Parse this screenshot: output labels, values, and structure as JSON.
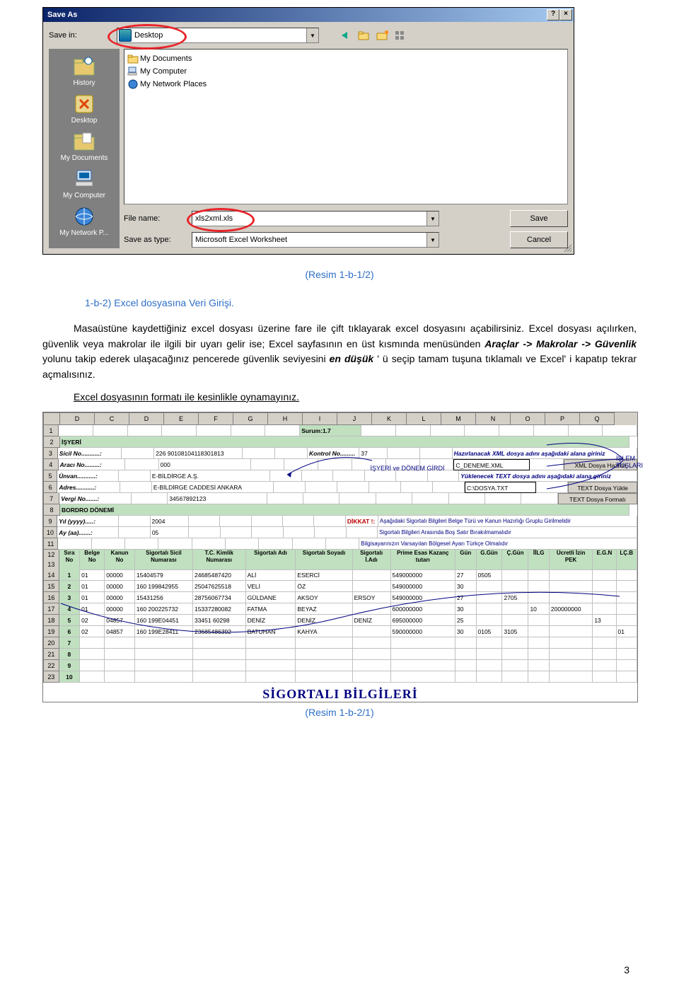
{
  "dialog": {
    "title": "Save As",
    "help_btn": "?",
    "close_btn": "×",
    "save_in_label": "Save in:",
    "save_in_value": "Desktop",
    "places": [
      {
        "label": "History"
      },
      {
        "label": "Desktop"
      },
      {
        "label": "My Documents"
      },
      {
        "label": "My Computer"
      },
      {
        "label": "My Network P..."
      }
    ],
    "files": [
      {
        "name": "My Documents"
      },
      {
        "name": "My Computer"
      },
      {
        "name": "My Network Places"
      }
    ],
    "file_name_label": "File name:",
    "file_name_value": "xls2xml.xls",
    "save_type_label": "Save as type:",
    "save_type_value": "Microsoft Excel Worksheet",
    "save_btn": "Save",
    "cancel_btn": "Cancel"
  },
  "caption1": "(Resim 1-b-1/2)",
  "heading": "1-b-2) Excel dosyasına Veri Girişi.",
  "para1_a": "Masaüstüne kaydettiğiniz excel dosyası üzerine fare ile çift tıklayarak excel dosyasını açabilirsiniz. Excel dosyası açılırken, güvenlik veya makrolar ile ilgili bir uyarı gelir ise; Excel sayfasının en üst kısmında menüsünden ",
  "para1_b": "Araçlar -> Makrolar -> Güvenlik",
  "para1_c": " yolunu takip ederek ulaşacağınız pencerede güvenlik seviyesini ",
  "para1_d": "en düşük",
  "para1_e": " ' ü seçip tamam tuşuna tıklamalı ve  Excel' i kapatıp tekrar açmalısınız.",
  "para2": "Excel dosyasının formatı ile kesinlikle oynamayınız.",
  "excel": {
    "cols": [
      "",
      "D",
      "C",
      "D",
      "E",
      "F",
      "G",
      "H",
      "I",
      "J",
      "K",
      "L",
      "M",
      "N",
      "O",
      "P",
      "Q"
    ],
    "surum": "Surum:1.7",
    "isyeri": "İŞYERİ",
    "sicil_no_lbl": "Sicil No...........:",
    "sicil_no_val": "226 90108104118301813",
    "kontrol_no_lbl": "Kontrol No.........",
    "kontrol_no_val": "37",
    "hazir_text": "Hazırlanacak XML dosya adını aşağıdaki alana giriniz",
    "araci_lbl": "Aracı No.........:",
    "araci_val": "000",
    "xml_name": "C_DENEME.XML",
    "xml_btn": "XML Dosya Hazırla",
    "unvan_lbl": "Ünvan...........:",
    "unvan_val": "E-BİLDİRGE A.Ş.",
    "yuklenecek": "Yüklenecek TEXT dosya adını aşağıdaki alana giriniz",
    "adres_lbl": "Adres...........:",
    "adres_val": "E-BİLDİRGE CADDESİ   ANKARA",
    "dosya_txt": "C:\\DOSYA.TXT",
    "txt_btn": "TEXT Dosya Yükle",
    "vergi_lbl": "Vergi No.......:",
    "vergi_val": "34567892123",
    "format_btn": "TEXT Dosya Formatı",
    "bordro": "BORDRO DÖNEMİ",
    "dikkat": "DİKKAT !:",
    "dikkat_a": "Aşağıdaki Sigortalı Bilgileri Belge Türü ve Kanun Hazırlığı Gruplu Girilmelidir",
    "yil_lbl": "Yıl (yyyy).....:",
    "yil_val": "2004",
    "dikkat_b": "Sigortalı Bilgileri Arasında Boş Satır Bırakılmamalıdır",
    "ay_lbl": "Ay (aa).......:",
    "ay_val": "05",
    "dikkat_c": "Bilgisayarınızın Varsayılan Bölgesel Ayarı Türkçe Olmalıdır",
    "islem_tus": "İŞLEM\nTUŞLARI",
    "isyeri_donem": "İŞYERİ ve DÖNEM GİRDİ",
    "headers": [
      "Sıra No",
      "Belge No",
      "Kanun No",
      "Sigortalı Sicil Numarası",
      "T.C. Kimlik Numarası",
      "Sigortalı Adı",
      "Sigortalı Soyadı",
      "Sigortalı İ.Adı",
      "Prime Esas Kazanç tutarı",
      "Gün",
      "G.Gün",
      "Ç.Gün",
      "İİLG",
      "Ücretli İzin PEK",
      "E.G.N",
      "LÇ.B"
    ],
    "rows": [
      {
        "n": "14",
        "sira": "1",
        "belge": "01",
        "kanun": "00000",
        "sicil": "15404579",
        "tc": "24685487420",
        "ad": "ALİ",
        "soy": "ESERCİ",
        "iki": "",
        "pek": "549000000",
        "gun": "27",
        "gg": "0505",
        "cg": "",
        "iilg": "",
        "uiz": "",
        "egn": "",
        "lcb": ""
      },
      {
        "n": "15",
        "sira": "2",
        "belge": "01",
        "kanun": "00000",
        "sicil": "160 199842955",
        "tc": "25047625518",
        "ad": "VELİ",
        "soy": "ÖZ",
        "iki": "",
        "pek": "549000000",
        "gun": "30",
        "gg": "",
        "cg": "",
        "iilg": "",
        "uiz": "",
        "egn": "",
        "lcb": ""
      },
      {
        "n": "16",
        "sira": "3",
        "belge": "01",
        "kanun": "00000",
        "sicil": "15431256",
        "tc": "28756067734",
        "ad": "GÜLDANE",
        "soy": "AKSOY",
        "iki": "ERSOY",
        "pek": "549000000",
        "gun": "27",
        "gg": "",
        "cg": "2705",
        "iilg": "",
        "uiz": "",
        "egn": "",
        "lcb": ""
      },
      {
        "n": "17",
        "sira": "4",
        "belge": "01",
        "kanun": "00000",
        "sicil": "160 200225732",
        "tc": "15337280082",
        "ad": "FATMA",
        "soy": "BEYAZ",
        "iki": "",
        "pek": "600000000",
        "gun": "30",
        "gg": "",
        "cg": "",
        "iilg": "10",
        "uiz": "200000000",
        "egn": "",
        "lcb": ""
      },
      {
        "n": "18",
        "sira": "5",
        "belge": "02",
        "kanun": "04857",
        "sicil": "160 199E04451",
        "tc": "33451 60298",
        "ad": "DENİZ",
        "soy": "DENİZ",
        "iki": "DENİZ",
        "pek": "695000000",
        "gun": "25",
        "gg": "",
        "cg": "",
        "iilg": "",
        "uiz": "",
        "egn": "13",
        "lcb": ""
      },
      {
        "n": "19",
        "sira": "6",
        "belge": "02",
        "kanun": "04857",
        "sicil": "160 199E28411",
        "tc": "23685486392",
        "ad": "BATUHAN",
        "soy": "KAHYA",
        "iki": "",
        "pek": "590000000",
        "gun": "30",
        "gg": "0105",
        "cg": "3105",
        "iilg": "",
        "uiz": "",
        "egn": "",
        "lcb": "01"
      }
    ],
    "blank_rows": [
      "20",
      "21",
      "22",
      "23"
    ],
    "blank_sira": [
      "7",
      "8",
      "9",
      "10"
    ],
    "footer_big": "SİGORTALI BİLGİLERİ"
  },
  "caption2": "(Resim 1-b-2/1)",
  "pagenum": "3"
}
